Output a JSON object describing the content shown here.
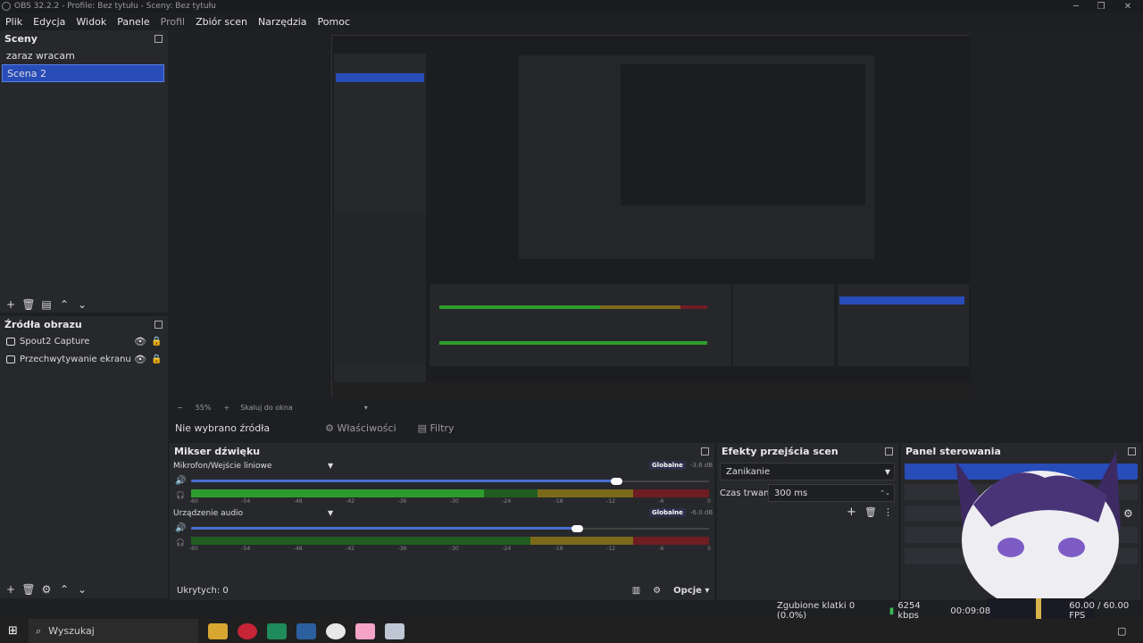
{
  "window": {
    "title": "OBS 32.2.2 - Profile: Bez tytułu - Sceny: Bez tytułu"
  },
  "menu": [
    "Plik",
    "Edycja",
    "Widok",
    "Panele",
    "Profil",
    "Zbiór scen",
    "Narzędzia",
    "Pomoc"
  ],
  "scenes": {
    "title": "Sceny",
    "items": [
      "zaraz wracam",
      "Scena 2"
    ],
    "selected": "Scena 2"
  },
  "sources": {
    "title": "Źródła obrazu",
    "items": [
      "Spout2 Capture",
      "Przechwytywanie ekranu"
    ]
  },
  "preview": {
    "zoom": "55%",
    "zoom_mode": "Skaluj do okna"
  },
  "source_bar": {
    "label": "Nie wybrano źródła",
    "properties": "Właściwości",
    "filters": "Filtry"
  },
  "mixer": {
    "title": "Mikser dźwięku",
    "tracks": [
      {
        "name": "Mikrofon/Wejście liniowe",
        "badge": "Globalne",
        "db": "-3.6 dB",
        "volume": 0.88
      },
      {
        "name": "Urządzenie audio",
        "badge": "Globalne",
        "db": "-6.0 dB",
        "volume": 0.82
      }
    ],
    "ticks": [
      "-60",
      "-54",
      "-48",
      "-42",
      "-36",
      "-30",
      "-24",
      "-18",
      "-12",
      "-6",
      "0"
    ],
    "hidden": "Ukrytych: 0",
    "options": "Opcje"
  },
  "transitions": {
    "title": "Efekty przejścia scen",
    "type": "Zanikanie",
    "duration_label": "Czas trwania",
    "duration": "300 ms"
  },
  "controls": {
    "title": "Panel sterowania"
  },
  "status": {
    "dropped": "Zgubione klatki 0 (0.0%)",
    "bitrate": "6254 kbps",
    "time": "00:09:08",
    "fps": "60.00 / 60.00 FPS"
  },
  "taskbar": {
    "search": "Wyszukaj"
  }
}
